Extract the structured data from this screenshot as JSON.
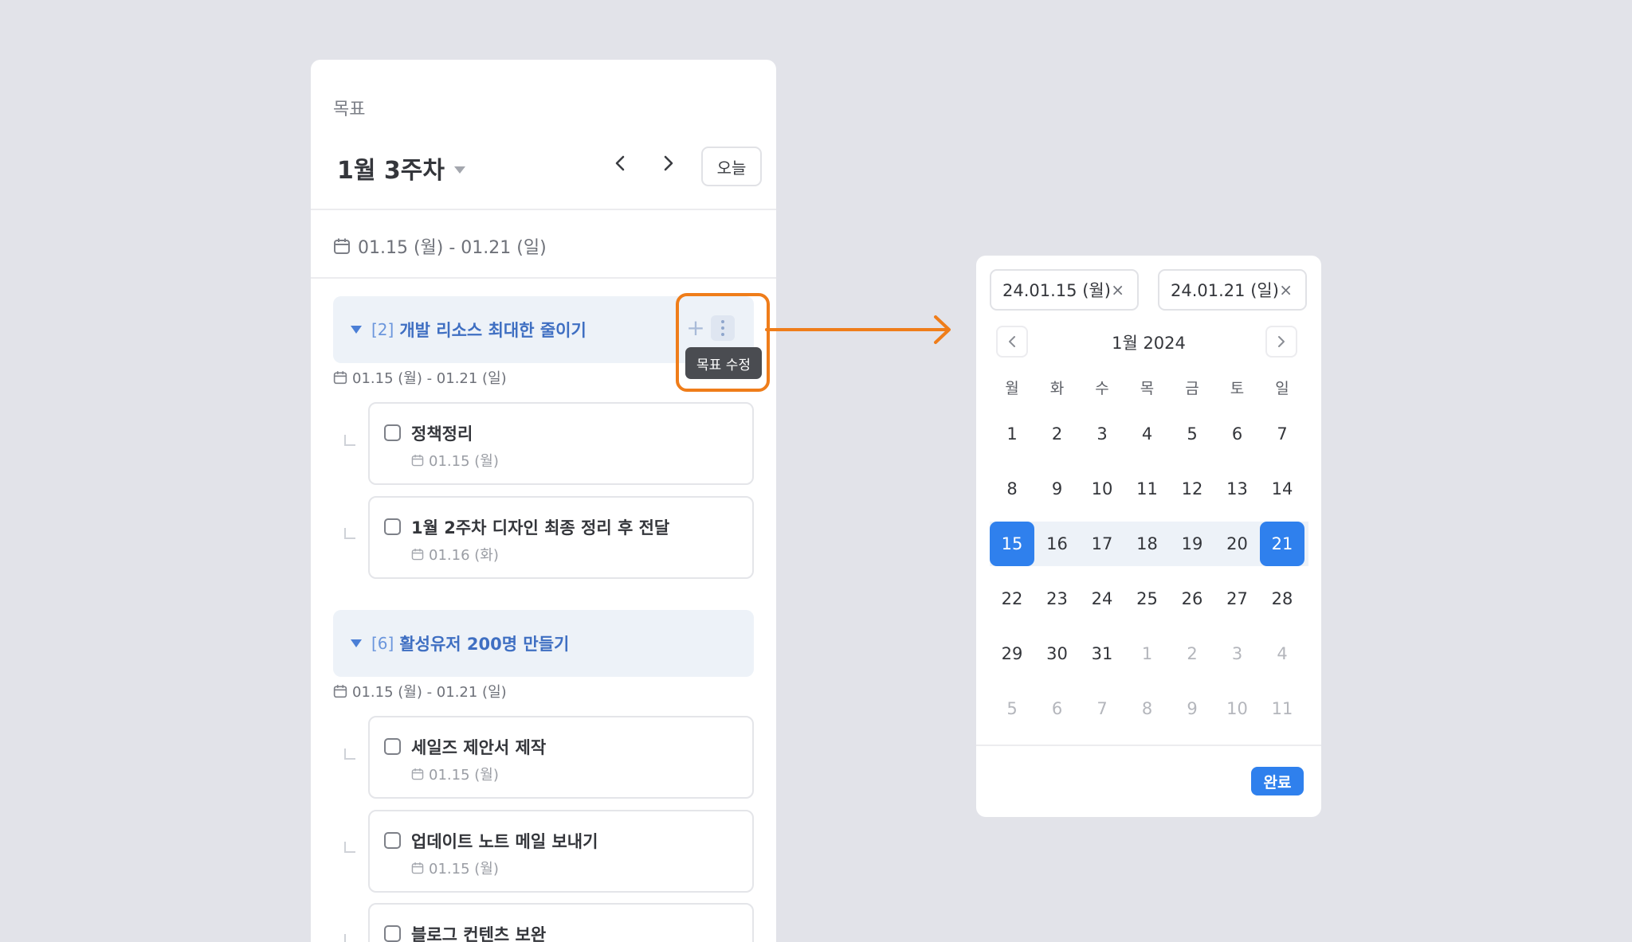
{
  "panel": {
    "label": "목표",
    "week_title": "1월 3주차",
    "today_label": "오늘",
    "range": "01.15 (월) - 01.21 (일)"
  },
  "goals": [
    {
      "count": "[2]",
      "title": "개발 리소스 최대한 줄이기",
      "dates": "01.15 (월) - 01.21 (일)",
      "tasks": [
        {
          "title": "정책정리",
          "date": "01.15 (월)"
        },
        {
          "title": "1월 2주차 디자인 최종 정리 후 전달",
          "date": "01.16 (화)"
        }
      ]
    },
    {
      "count": "[6]",
      "title": "활성유저 200명 만들기",
      "dates": "01.15 (월) - 01.21 (일)",
      "tasks": [
        {
          "title": "세일즈 제안서 제작",
          "date": "01.15 (월)"
        },
        {
          "title": "업데이트 노트 메일 보내기",
          "date": "01.15 (월)"
        },
        {
          "title": "블로그 컨텐츠 보완",
          "date": ""
        }
      ]
    }
  ],
  "goal_actions": {
    "add_icon": "+",
    "tooltip": "목표 수정"
  },
  "picker": {
    "start_date": "24.01.15 (월)",
    "end_date": "24.01.21 (일)",
    "clear_icon": "×",
    "month_label": "1월 2024",
    "weekdays": [
      "월",
      "화",
      "수",
      "목",
      "금",
      "토",
      "일"
    ],
    "weeks": [
      [
        "1",
        "2",
        "3",
        "4",
        "5",
        "6",
        "7"
      ],
      [
        "8",
        "9",
        "10",
        "11",
        "12",
        "13",
        "14"
      ],
      [
        "15",
        "16",
        "17",
        "18",
        "19",
        "20",
        "21"
      ],
      [
        "22",
        "23",
        "24",
        "25",
        "26",
        "27",
        "28"
      ],
      [
        "29",
        "30",
        "31",
        "1",
        "2",
        "3",
        "4"
      ],
      [
        "5",
        "6",
        "7",
        "8",
        "9",
        "10",
        "11"
      ]
    ],
    "done_label": "완료"
  },
  "colors": {
    "accent": "#2f80ed",
    "highlight": "#ef7d1a",
    "goal_bg": "#edf2f8",
    "goal_text": "#3f6fc2"
  }
}
